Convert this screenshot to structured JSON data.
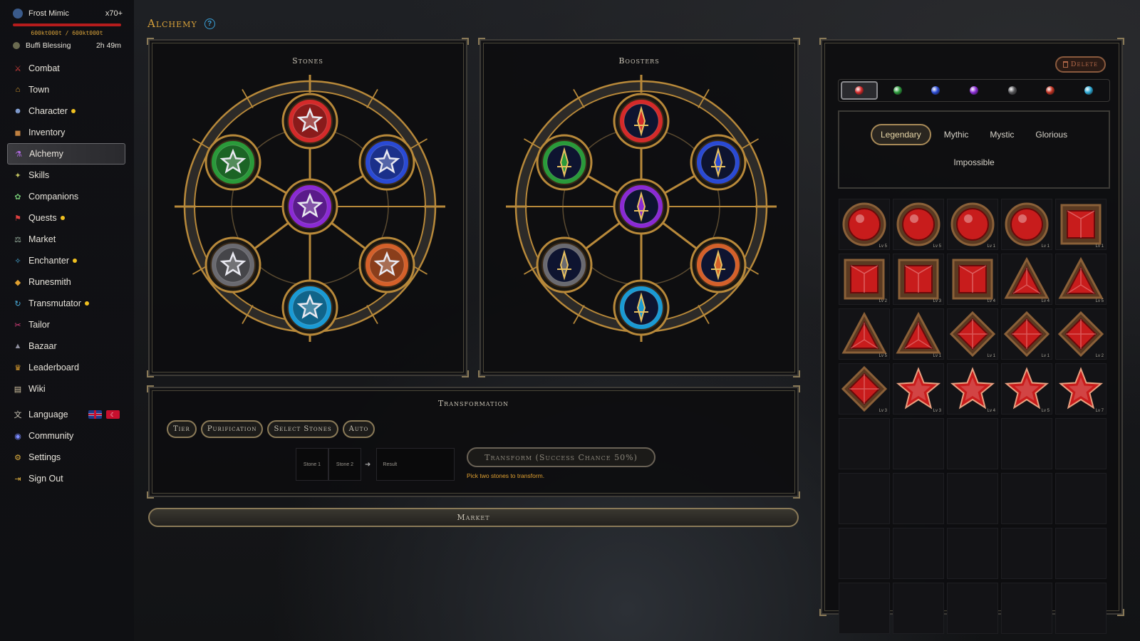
{
  "player": {
    "name": "Frost Mimic",
    "count": "x70+",
    "hp_text": "600kt000t / 600kt000t",
    "hp_fraction": 1.0,
    "buff": {
      "name": "Buffi Blessing",
      "time": "2h 49m"
    }
  },
  "nav": {
    "items": [
      {
        "label": "Combat",
        "icon": "crossed-swords-icon",
        "dot": false
      },
      {
        "label": "Town",
        "icon": "town-icon",
        "dot": false
      },
      {
        "label": "Character",
        "icon": "character-icon",
        "dot": true
      },
      {
        "label": "Inventory",
        "icon": "bag-icon",
        "dot": false
      },
      {
        "label": "Alchemy",
        "icon": "potion-icon",
        "dot": false,
        "active": true
      },
      {
        "label": "Skills",
        "icon": "skills-icon",
        "dot": false
      },
      {
        "label": "Companions",
        "icon": "paw-icon",
        "dot": false
      },
      {
        "label": "Quests",
        "icon": "quest-icon",
        "dot": true
      },
      {
        "label": "Market",
        "icon": "scales-icon",
        "dot": false
      },
      {
        "label": "Enchanter",
        "icon": "wand-icon",
        "dot": true
      },
      {
        "label": "Runesmith",
        "icon": "rune-icon",
        "dot": false
      },
      {
        "label": "Transmutator",
        "icon": "transmute-icon",
        "dot": true
      },
      {
        "label": "Tailor",
        "icon": "needle-icon",
        "dot": false
      },
      {
        "label": "Bazaar",
        "icon": "bazaar-icon",
        "dot": false
      },
      {
        "label": "Leaderboard",
        "icon": "trophy-icon",
        "dot": false
      },
      {
        "label": "Wiki",
        "icon": "book-icon",
        "dot": false
      }
    ],
    "language": "Language",
    "community": "Community",
    "settings": "Settings",
    "sign_out": "Sign Out"
  },
  "header": {
    "title": "Alchemy",
    "help": "?"
  },
  "stones": {
    "title": "Stones",
    "colors": [
      "#d42a2a",
      "#2a9a3a",
      "#2a4ad4",
      "#8a2ad4",
      "#6a6a70",
      "#d4602a",
      "#1a9ad4"
    ]
  },
  "boosters": {
    "title": "Boosters"
  },
  "transformation": {
    "title": "Transformation",
    "pills": [
      "Tier",
      "Purification",
      "Select Stones",
      "Auto"
    ],
    "stone1": "Stone 1",
    "stone2": "Stone 2",
    "result": "Result",
    "transform_button": "Transform (Success Chance 50%)",
    "hint": "Pick two stones to transform."
  },
  "market_button": "Market",
  "inventory": {
    "delete": "Delete",
    "color_tabs": [
      "#d42a2a",
      "#2a9a3a",
      "#2a4ad4",
      "#8a2ad4",
      "#555558",
      "#c03020",
      "#2aa8d4"
    ],
    "rarity": [
      "Legendary",
      "Mythic",
      "Mystic",
      "Glorious"
    ],
    "rarity_active": "Legendary",
    "rarity_row2": "Impossible",
    "items": [
      {
        "shape": "round",
        "lv": "Lv 5"
      },
      {
        "shape": "round",
        "lv": "Lv 5"
      },
      {
        "shape": "round",
        "lv": "Lv 1"
      },
      {
        "shape": "round",
        "lv": "Lv 1"
      },
      {
        "shape": "square",
        "lv": "Lv 1"
      },
      {
        "shape": "square",
        "lv": "Lv 2"
      },
      {
        "shape": "square",
        "lv": "Lv 3"
      },
      {
        "shape": "square",
        "lv": "Lv 4"
      },
      {
        "shape": "triangle",
        "lv": "Lv 4"
      },
      {
        "shape": "triangle",
        "lv": "Lv 5"
      },
      {
        "shape": "triangle",
        "lv": "Lv 5"
      },
      {
        "shape": "triangle",
        "lv": "Lv 1"
      },
      {
        "shape": "diamond",
        "lv": "Lv 1"
      },
      {
        "shape": "diamond",
        "lv": "Lv 1"
      },
      {
        "shape": "diamond",
        "lv": "Lv 2"
      },
      {
        "shape": "diamond",
        "lv": "Lv 3"
      },
      {
        "shape": "star",
        "lv": "Lv 3"
      },
      {
        "shape": "star",
        "lv": "Lv 4"
      },
      {
        "shape": "star",
        "lv": "Lv 5"
      },
      {
        "shape": "star",
        "lv": "Lv 7"
      }
    ],
    "empty_cells": 20
  }
}
